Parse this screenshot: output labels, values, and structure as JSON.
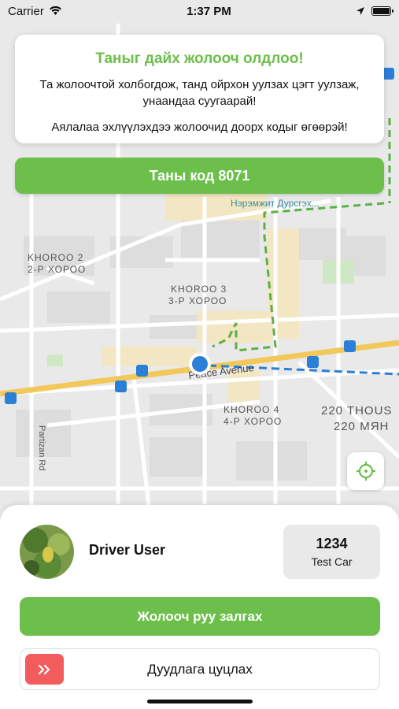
{
  "status_bar": {
    "carrier": "Carrier",
    "time": "1:37 PM"
  },
  "map": {
    "labels": {
      "khoroo2_a": "KHOROO 2",
      "khoroo2_b": "2-Р ХОРОО",
      "khoroo3_a": "KHOROO 3",
      "khoroo3_b": "3-Р ХОРОО",
      "khoroo4_a": "KHOROO 4",
      "khoroo4_b": "4-Р ХОРОО",
      "thous_a": "220 THOUS",
      "thous_b": "220 МЯН",
      "street": "Peace Avenue",
      "partizan": "Partizan Rd",
      "poi": "Нэрэмжит Дурсгэх..."
    },
    "colors": {
      "route_green": "#5db043",
      "route_blue": "#2c7fd6",
      "road_major": "#f2c85b",
      "block": "#dcdcdc",
      "accent": "#6cbf4a"
    }
  },
  "info_card": {
    "title": "Таныг дайх жолооч олдлоо!",
    "text1": "Та жолоочтой холбогдож, танд ойрхон уулзах цэгт уулзаж, унаандаа суугаарай!",
    "text2": "Аялалаа эхлүүлэхдээ жолоочид доорх кодыг өгөөрэй!"
  },
  "code_button": {
    "label": "Таны код 8071"
  },
  "locate_button": {
    "icon": "crosshair-icon"
  },
  "driver": {
    "name": "Driver User",
    "car_number": "1234",
    "car_model": "Test Car"
  },
  "actions": {
    "call_label": "Жолооч руу залгах",
    "cancel_label": "Дуудлага цуцлах",
    "cancel_icon": "chevrons-right-icon"
  }
}
